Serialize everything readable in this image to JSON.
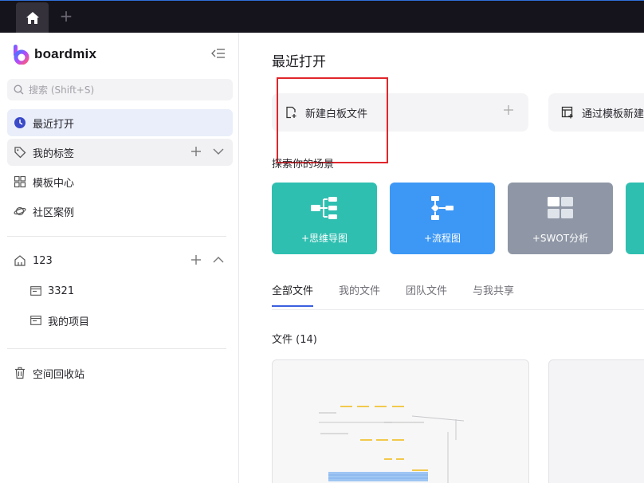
{
  "app": {
    "name": "boardmix"
  },
  "titlebar": {
    "add_tab_label": "+"
  },
  "sidebar": {
    "search_placeholder": "搜索 (Shift+S)",
    "items": [
      {
        "label": "最近打开",
        "icon": "clock-icon",
        "active": true
      },
      {
        "label": "我的标签",
        "icon": "tag-icon"
      },
      {
        "label": "模板中心",
        "icon": "grid-icon"
      },
      {
        "label": "社区案例",
        "icon": "planet-icon"
      }
    ],
    "space": {
      "name": "123",
      "folders": [
        {
          "label": "3321",
          "icon": "folder-icon"
        },
        {
          "label": "我的项目",
          "icon": "folder-icon"
        }
      ]
    },
    "trash_label": "空间回收站"
  },
  "main": {
    "title": "最近打开",
    "actions": [
      {
        "label": "新建白板文件",
        "icon": "new-board-icon"
      },
      {
        "label": "通过模板新建",
        "icon": "template-icon"
      }
    ],
    "scenes_title": "探索你的场景",
    "scenes": [
      {
        "label": "+思维导图",
        "color": "#2fbfb1"
      },
      {
        "label": "+流程图",
        "color": "#3d98f5"
      },
      {
        "label": "+SWOT分析",
        "color": "#8f97a6"
      },
      {
        "label": "",
        "color": "#2fbfb1"
      }
    ],
    "tabs": [
      "全部文件",
      "我的文件",
      "团队文件",
      "与我共享"
    ],
    "active_tab": "全部文件",
    "file_count": "文件 (14)"
  },
  "colors": {
    "accent": "#3b5fe0",
    "highlight": "#e0262b",
    "titlebar_bg": "#15131c"
  }
}
